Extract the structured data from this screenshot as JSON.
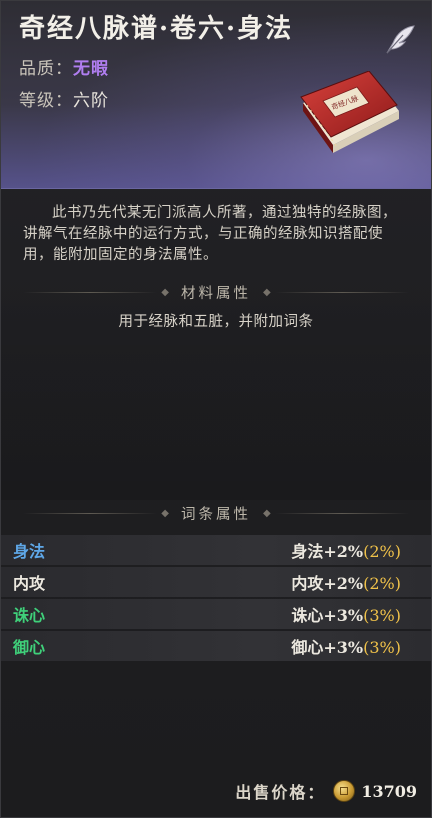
{
  "item": {
    "title": "奇经八脉谱·卷六·身法",
    "quality_label": "品质：",
    "quality_value": "无暇",
    "level_label": "等级：",
    "level_value": "六阶",
    "book_cover_text": "奇经八脉"
  },
  "description": "此书乃先代某无门派高人所著，通过独特的经脉图，讲解气在经脉中的运行方式，与正确的经脉知识搭配使用，能附加固定的身法属性。",
  "material": {
    "header": "材料属性",
    "text": "用于经脉和五脏，并附加词条"
  },
  "attributes": {
    "header": "词条属性",
    "rows": [
      {
        "name": "身法",
        "color": "#5fa8e8",
        "value": "身法+2%",
        "bonus": "(2%)"
      },
      {
        "name": "内攻",
        "color": "#ece8df",
        "value": "内攻+2%",
        "bonus": "(2%)"
      },
      {
        "name": "诛心",
        "color": "#3fd07a",
        "value": "诛心+3%",
        "bonus": "(3%)"
      },
      {
        "name": "御心",
        "color": "#3fd07a",
        "value": "御心+3%",
        "bonus": "(3%)"
      }
    ]
  },
  "footer": {
    "price_label": "出售价格：",
    "price": "13709"
  },
  "icons": {
    "close": "quill-close-icon",
    "book": "book-icon",
    "coin": "coin-icon"
  }
}
